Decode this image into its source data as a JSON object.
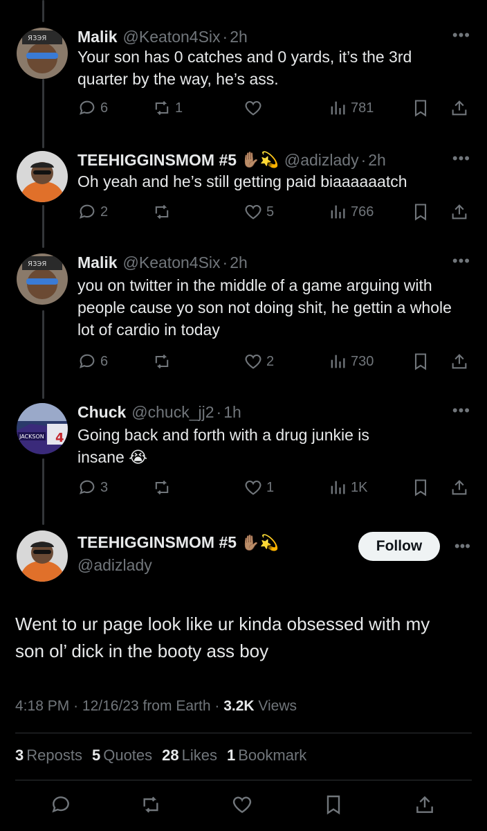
{
  "replies": [
    {
      "name": "Malik",
      "emoji": "",
      "handle": "@Keaton4Six",
      "time": "2h",
      "text": "Your son has 0 catches and 0 yards, it’s the 3rd quarter by the way, he’s ass.",
      "replies": "6",
      "reposts": "1",
      "likes": "",
      "views": "781",
      "avatar_icon": "sunglasses-avatar-icon"
    },
    {
      "name": "TEEHIGGINSMOM #5",
      "emoji": "✋🏽💫",
      "handle": "@adizlady",
      "time": "2h",
      "text": "Oh yeah and he’s still getting paid biaaaaaatch",
      "replies": "2",
      "reposts": "",
      "likes": "5",
      "views": "766",
      "avatar_icon": "orange-hoodie-avatar-icon"
    },
    {
      "name": "Malik",
      "emoji": "",
      "handle": "@Keaton4Six",
      "time": "2h",
      "text": "you on twitter in the middle of a game arguing with people cause yo son not doing shit, he gettin a whole lot of cardio in today",
      "replies": "6",
      "reposts": "",
      "likes": "2",
      "views": "730",
      "avatar_icon": "sunglasses-avatar-icon"
    },
    {
      "name": "Chuck",
      "emoji": "",
      "handle": "@chuck_jj2",
      "time": "1h",
      "text": "Going back and forth with a drug junkie is insane 😭",
      "replies": "3",
      "reposts": "",
      "likes": "1",
      "views": "1K",
      "avatar_icon": "football-jersey-avatar-icon"
    }
  ],
  "main": {
    "name": "TEEHIGGINSMOM #5",
    "emoji": "✋🏽💫",
    "handle": "@adizlady",
    "follow_label": "Follow",
    "text": "Went to ur page look like ur kinda obsessed with my son ol’ dick in the booty ass boy",
    "time": "4:18 PM",
    "date": "12/16/23",
    "source": "from Earth",
    "views_count": "3.2K",
    "views_label": "Views",
    "reposts_count": "3",
    "reposts_label": "Reposts",
    "quotes_count": "5",
    "quotes_label": "Quotes",
    "likes_count": "28",
    "likes_label": "Likes",
    "bookmarks_count": "1",
    "bookmarks_label": "Bookmark"
  },
  "colors": {
    "background": "#000000",
    "text": "#e7e9ea",
    "muted": "#71767b",
    "follow_bg": "#eff3f4"
  }
}
